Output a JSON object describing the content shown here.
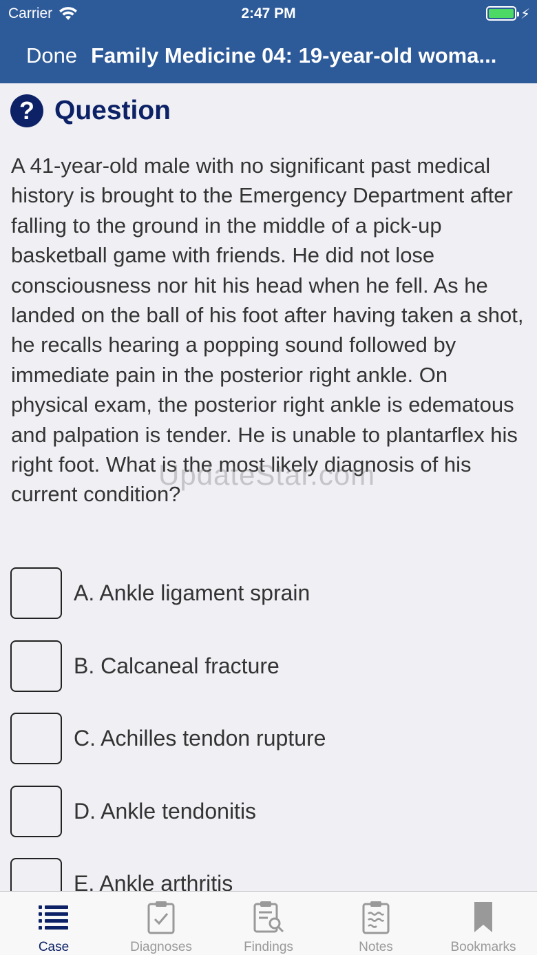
{
  "status_bar": {
    "carrier": "Carrier",
    "time": "2:47 PM"
  },
  "nav": {
    "done_label": "Done",
    "title": "Family Medicine 04: 19-year-old woma..."
  },
  "question": {
    "icon": "question-circle-icon",
    "heading": "Question",
    "text": "A 41-year-old male with no significant past medical history is brought to the Emergency Department after falling to the ground in the middle of a pick-up basketball game with friends. He did not lose consciousness nor hit his head when he fell. As he landed on the ball of his foot after having taken a shot, he recalls hearing a popping sound followed by immediate pain in the posterior right ankle. On physical exam, the posterior right ankle is edematous and palpation is tender. He is unable to plantarflex his right foot. What is the most likely diagnosis of his current condition?"
  },
  "options": [
    {
      "label": "A. Ankle ligament sprain",
      "checked": false
    },
    {
      "label": "B. Calcaneal fracture",
      "checked": false
    },
    {
      "label": "C. Achilles tendon rupture",
      "checked": false
    },
    {
      "label": "D. Ankle tendonitis",
      "checked": false
    },
    {
      "label": "E. Ankle arthritis",
      "checked": false
    }
  ],
  "watermark": "UpdateStar.com",
  "tabs": [
    {
      "label": "Case",
      "icon": "list-icon",
      "active": true
    },
    {
      "label": "Diagnoses",
      "icon": "clipboard-check-icon",
      "active": false
    },
    {
      "label": "Findings",
      "icon": "clipboard-search-icon",
      "active": false
    },
    {
      "label": "Notes",
      "icon": "clipboard-notes-icon",
      "active": false
    },
    {
      "label": "Bookmarks",
      "icon": "bookmark-icon",
      "active": false
    }
  ],
  "colors": {
    "nav_bg": "#2d5a99",
    "accent": "#0d2266",
    "battery": "#4cd964",
    "tab_inactive": "#999999"
  }
}
